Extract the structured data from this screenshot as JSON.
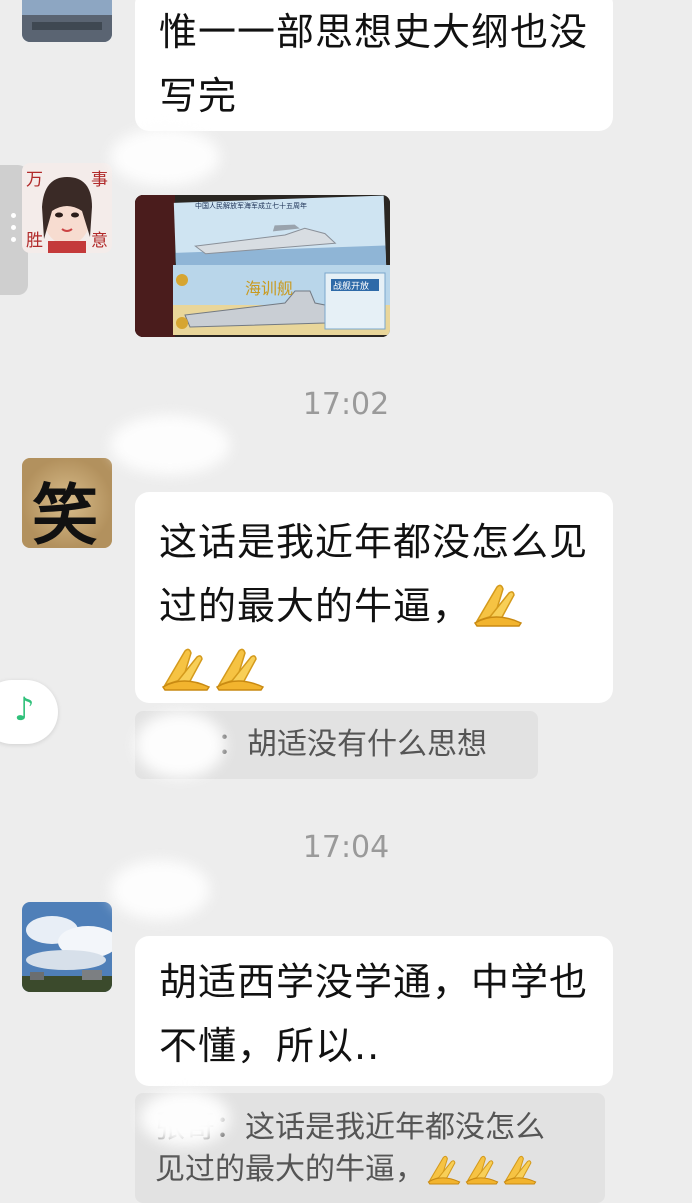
{
  "messages": [
    {
      "text": "惟一一部思想史大纲也没写完"
    },
    {
      "text": "这话是我近年都没怎么见过的最大的牛逼，"
    },
    {
      "text": "胡适西学没学通，中学也不懂，所以.."
    }
  ],
  "avatar_labels": {
    "c1": "万",
    "c2": "事",
    "c3": "胜",
    "c4": "意"
  },
  "avatar_calligraphy": "笑",
  "image_texts": {
    "top": "中国人民解放军海军成立七十五周年",
    "bottom": "海训舰",
    "banner": "战舰开放"
  },
  "timestamps": [
    "17:02",
    "17:04"
  ],
  "quotes": [
    {
      "sep": "：",
      "text": "胡适没有什么思想"
    },
    {
      "name": "张哥",
      "sep": "：",
      "text": "这话是我近年都没怎么",
      "line2": "见过的最大的牛逼，"
    }
  ],
  "icons": {
    "emoji": "folded-hands",
    "music": "music-note-icon",
    "side_menu": "more-vertical-icon"
  },
  "colors": {
    "background": "#ededed",
    "bubble": "#ffffff",
    "quote_bg": "#e2e2e2",
    "accent": "#2fc07a"
  }
}
